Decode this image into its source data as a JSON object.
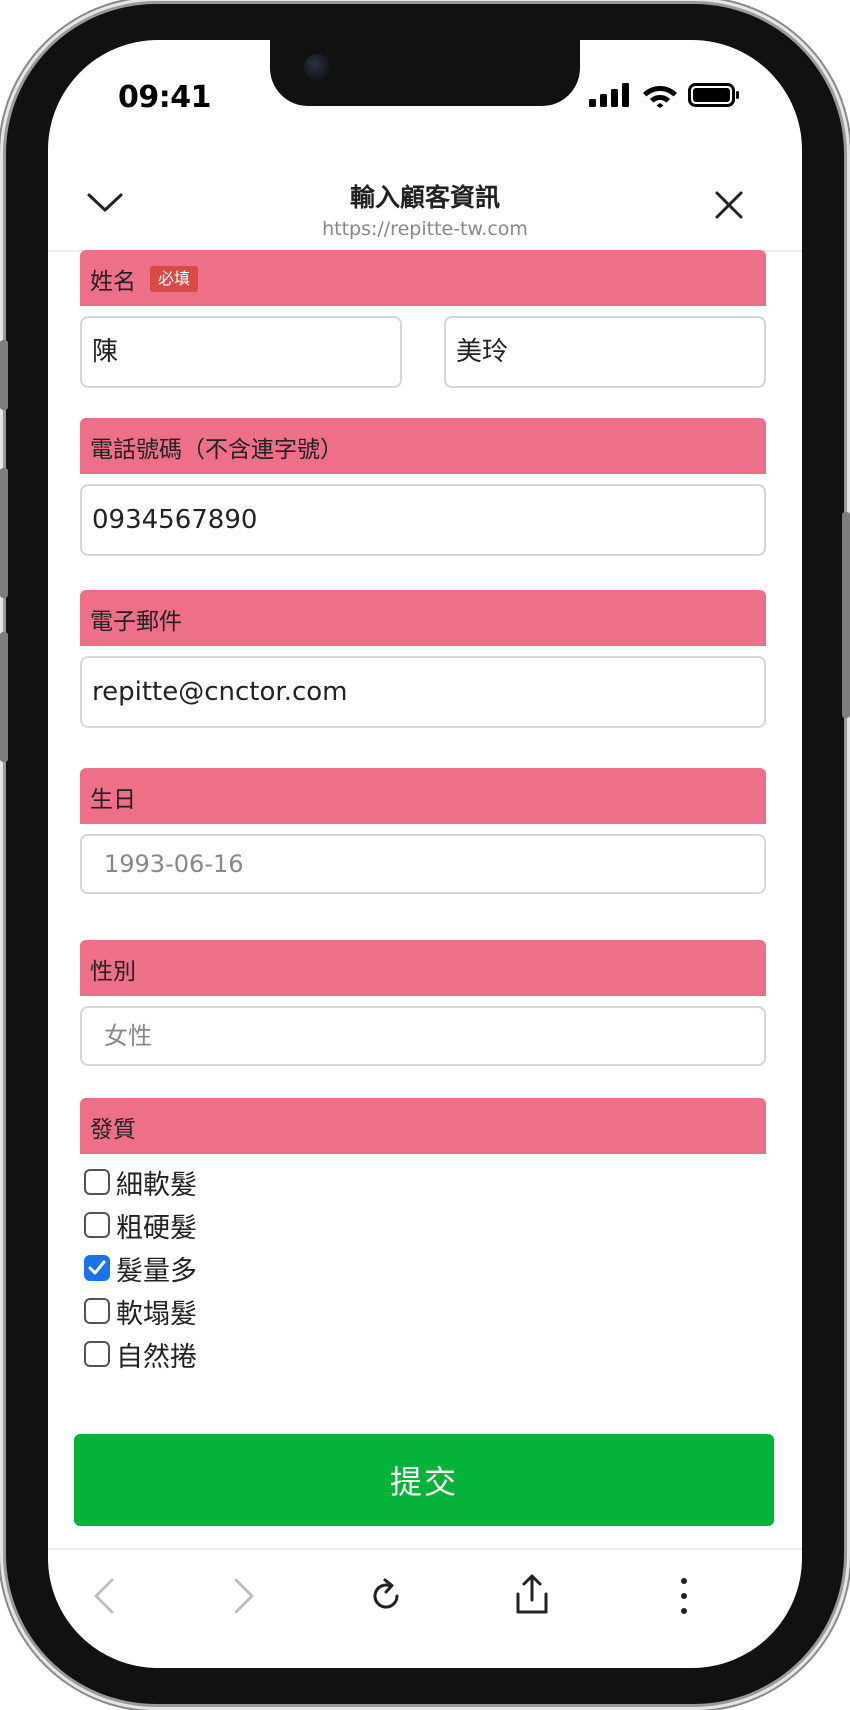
{
  "status_bar": {
    "time": "09:41"
  },
  "browser": {
    "title": "輸入顧客資訊",
    "url": "https://repitte-tw.com"
  },
  "form": {
    "name": {
      "label": "姓名",
      "required_badge": "必填",
      "last_name": "陳",
      "first_name": "美玲"
    },
    "phone": {
      "label": "電話號碼（不含連字號）",
      "value": "0934567890"
    },
    "email": {
      "label": "電子郵件",
      "value": "repitte@cnctor.com"
    },
    "birthday": {
      "label": "生日",
      "value": "1993-06-16"
    },
    "gender": {
      "label": "性別",
      "value": "女性"
    },
    "hair_type": {
      "label": "發質",
      "options": [
        {
          "label": "細軟髮",
          "checked": false
        },
        {
          "label": "粗硬髮",
          "checked": false
        },
        {
          "label": "髮量多",
          "checked": true
        },
        {
          "label": "軟塌髮",
          "checked": false
        },
        {
          "label": "自然捲",
          "checked": false
        }
      ]
    },
    "submit_label": "提交"
  },
  "colors": {
    "section_header": "#ee6f88",
    "required_badge": "#d84a46",
    "submit_button": "#06b33a",
    "checkbox_checked": "#1a73e8"
  },
  "icons": {
    "nav": [
      "chevron-down-icon",
      "close-icon"
    ],
    "status": [
      "signal-icon",
      "wifi-icon",
      "battery-icon"
    ],
    "toolbar": [
      "back-icon",
      "forward-icon",
      "reload-icon",
      "share-icon",
      "more-icon"
    ]
  }
}
